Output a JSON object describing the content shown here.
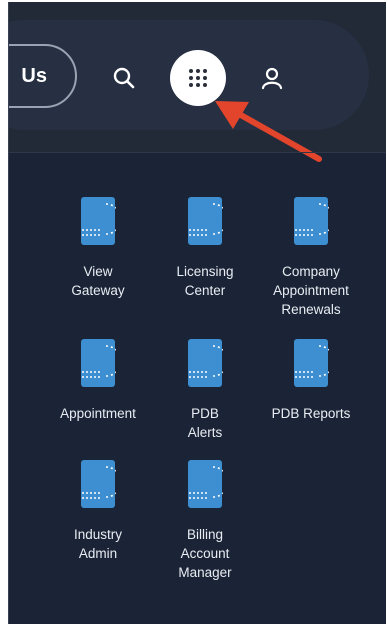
{
  "header": {
    "contact_label": "Us",
    "search_icon": "search-icon",
    "apps_icon": "grid-icon",
    "user_icon": "user-icon",
    "colors": {
      "background": "#1b2436",
      "header": "#222a38",
      "arrow": "#e2452b",
      "app_icon": "#3d8fd1"
    }
  },
  "apps": [
    {
      "label": "View\nGateway"
    },
    {
      "label": "Licensing\nCenter"
    },
    {
      "label": "Company\nAppointment\nRenewals"
    },
    {
      "label": "Appointment"
    },
    {
      "label": "PDB\nAlerts"
    },
    {
      "label": "PDB Reports"
    },
    {
      "label": "Industry\nAdmin"
    },
    {
      "label": "Billing\nAccount\nManager"
    }
  ]
}
